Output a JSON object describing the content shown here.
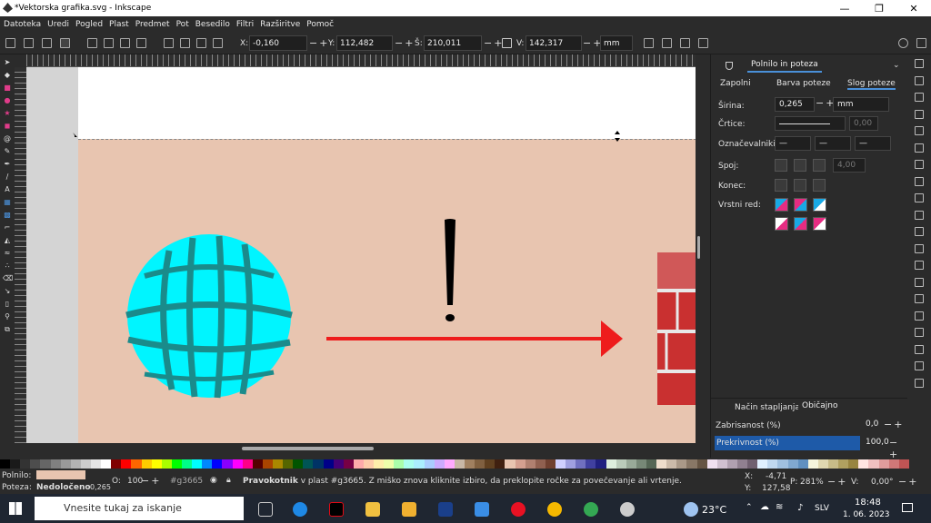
{
  "window": {
    "title": "*Vektorska grafika.svg - Inkscape",
    "controls": [
      "—",
      "❐",
      "✕"
    ]
  },
  "menu": [
    "Datoteka",
    "Uredi",
    "Pogled",
    "Plast",
    "Predmet",
    "Pot",
    "Besedilo",
    "Filtri",
    "Razširitve",
    "Pomoč"
  ],
  "toolbar": {
    "x_label": "X:",
    "x_value": "-0,160",
    "y_label": "Y:",
    "y_value": "112,482",
    "w_label": "Š:",
    "w_value": "210,011",
    "h_label": "V:",
    "h_value": "142,317",
    "unit": "mm"
  },
  "panel": {
    "tab": "Polnilo in poteza",
    "subtabs": [
      "Zapolni",
      "Barva poteze",
      "Slog poteze"
    ],
    "width_label": "Širina:",
    "width_value": "0,265",
    "width_unit": "mm",
    "dashes_label": "Črtice:",
    "dashes_value": "0,00",
    "markers_label": "Označevalniki:",
    "join_label": "Spoj:",
    "join_value": "4,00",
    "cap_label": "Konec:",
    "order_label": "Vrstni red:",
    "blend_label": "Način stapljanja:",
    "blend_value": "Običajno",
    "blur_label": "Zabrisanost (%)",
    "blur_value": "0,0",
    "opacity_label": "Prekrivnost (%)",
    "opacity_value": "100,0"
  },
  "status": {
    "fill_label": "Polnilo:",
    "stroke_label": "Poteza:",
    "stroke_value": "Nedoločeno",
    "stroke_width": "0,265",
    "opacity_label": "O:",
    "opacity_value": "100",
    "object_id": "#g3665",
    "message_bold": "Pravokotnik",
    "message_rest": " v plast #g3665. Z miško znova kliknite izbiro, da preklopite ročke za povečevanje ali vrtenje.",
    "x_label": "X:",
    "x_value": "-4,71",
    "y_label": "Y:",
    "y_value": "127,58",
    "zoom_label": "P:",
    "zoom_value": "281%",
    "rot_label": "V:",
    "rot_value": "0,00°"
  },
  "taskbar": {
    "search_placeholder": "Vnesite tukaj za iskanje",
    "weather": "23°C",
    "lang": "SLV",
    "time": "18:48",
    "date": "1. 06. 2023"
  },
  "colors": {
    "rect_fill": "#e8c5b0",
    "accent": "#4a90d9"
  }
}
